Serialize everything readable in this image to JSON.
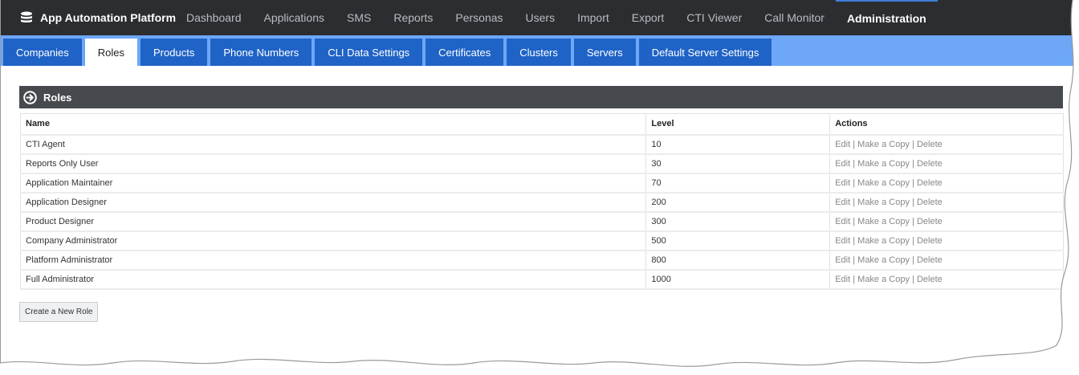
{
  "app": {
    "title": "App Automation Platform"
  },
  "topnav": [
    {
      "label": "Dashboard"
    },
    {
      "label": "Applications"
    },
    {
      "label": "SMS"
    },
    {
      "label": "Reports"
    },
    {
      "label": "Personas"
    },
    {
      "label": "Users"
    },
    {
      "label": "Import"
    },
    {
      "label": "Export"
    },
    {
      "label": "CTI Viewer"
    },
    {
      "label": "Call Monitor"
    },
    {
      "label": "Administration",
      "active": true
    }
  ],
  "tabs": [
    {
      "label": "Companies"
    },
    {
      "label": "Roles",
      "active": true
    },
    {
      "label": "Products"
    },
    {
      "label": "Phone Numbers"
    },
    {
      "label": "CLI Data Settings"
    },
    {
      "label": "Certificates"
    },
    {
      "label": "Clusters"
    },
    {
      "label": "Servers"
    },
    {
      "label": "Default Server Settings"
    }
  ],
  "panel": {
    "title": "Roles"
  },
  "table": {
    "columns": [
      "Name",
      "Level",
      "Actions"
    ],
    "actions": {
      "edit": "Edit",
      "copy": "Make a Copy",
      "delete": "Delete",
      "separator": "|"
    },
    "rows": [
      {
        "name": "CTI Agent",
        "level": "10"
      },
      {
        "name": "Reports Only User",
        "level": "30"
      },
      {
        "name": "Application Maintainer",
        "level": "70"
      },
      {
        "name": "Application Designer",
        "level": "200"
      },
      {
        "name": "Product Designer",
        "level": "300"
      },
      {
        "name": "Company Administrator",
        "level": "500"
      },
      {
        "name": "Platform Administrator",
        "level": "800"
      },
      {
        "name": "Full Administrator",
        "level": "1000"
      }
    ]
  },
  "create_button": {
    "label": "Create a New Role"
  },
  "colors": {
    "topbar": "#2b2d30",
    "subbar": "#6da7f6",
    "tab": "#1f63c6",
    "panel_header": "#46494e",
    "active_underline": "#3f7fd9"
  }
}
